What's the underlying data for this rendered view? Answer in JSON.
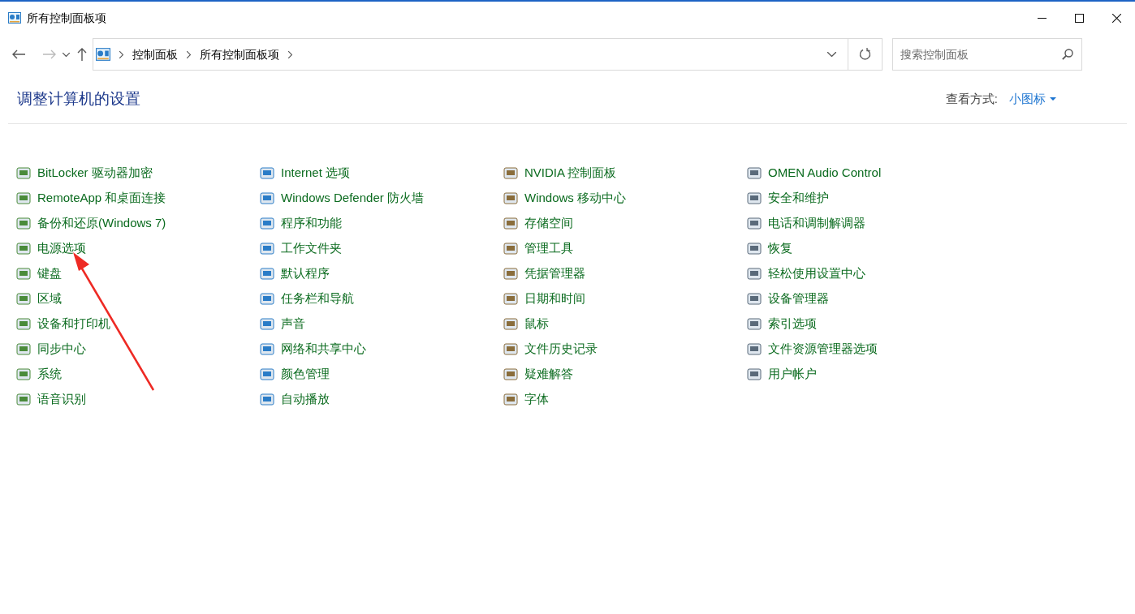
{
  "window": {
    "title": "所有控制面板项"
  },
  "address_bar": {
    "path": [
      "控制面板",
      "所有控制面板项"
    ]
  },
  "search": {
    "placeholder": "搜索控制面板"
  },
  "heading": "调整计算机的设置",
  "view_by": {
    "label": "查看方式:",
    "value": "小图标"
  },
  "columns": [
    [
      "BitLocker 驱动器加密",
      "RemoteApp 和桌面连接",
      "备份和还原(Windows 7)",
      "电源选项",
      "键盘",
      "区域",
      "设备和打印机",
      "同步中心",
      "系统",
      "语音识别"
    ],
    [
      "Internet 选项",
      "Windows Defender 防火墙",
      "程序和功能",
      "工作文件夹",
      "默认程序",
      "任务栏和导航",
      "声音",
      "网络和共享中心",
      "颜色管理",
      "自动播放"
    ],
    [
      "NVIDIA 控制面板",
      "Windows 移动中心",
      "存储空间",
      "管理工具",
      "凭据管理器",
      "日期和时间",
      "鼠标",
      "文件历史记录",
      "疑难解答",
      "字体"
    ],
    [
      "OMEN Audio Control",
      "安全和维护",
      "电话和调制解调器",
      "恢复",
      "轻松使用设置中心",
      "设备管理器",
      "索引选项",
      "文件资源管理器选项",
      "用户帐户"
    ]
  ]
}
